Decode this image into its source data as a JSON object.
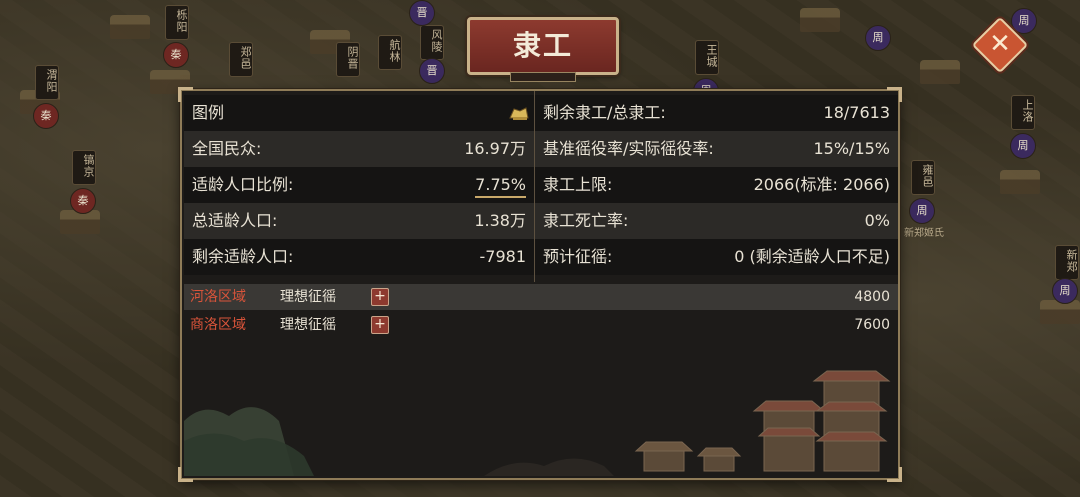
{
  "title": "隶工",
  "close_icon": "close-icon",
  "left_stats": [
    {
      "label": "图例",
      "value": "",
      "icon": "legend-icon"
    },
    {
      "label": "全国民众:",
      "value": "16.97万"
    },
    {
      "label": "适龄人口比例:",
      "value": "7.75%"
    },
    {
      "label": "总适龄人口:",
      "value": "1.38万"
    },
    {
      "label": "剩余适龄人口:",
      "value": "-7981"
    }
  ],
  "right_stats": [
    {
      "label": "剩余隶工/总隶工:",
      "value": "18/7613"
    },
    {
      "label": "基准徭役率/实际徭役率:",
      "value": "15%/15%"
    },
    {
      "label": "隶工上限:",
      "value": "2066(标准: 2066)"
    },
    {
      "label": "隶工死亡率:",
      "value": "0%"
    },
    {
      "label": "预计征徭:",
      "value": "0 (剩余适龄人口不足)"
    }
  ],
  "regions": [
    {
      "name": "河洛区域",
      "mode": "理想征徭",
      "plus": "+",
      "value": "4800"
    },
    {
      "name": "商洛区域",
      "mode": "理想征徭",
      "plus": "+",
      "value": "7600"
    }
  ],
  "map_labels": [
    {
      "text": "栎阳"
    },
    {
      "text": "郑邑"
    },
    {
      "text": "阴晋"
    },
    {
      "text": "航林"
    },
    {
      "text": "风陵"
    },
    {
      "text": "渭阳"
    },
    {
      "text": "镐京"
    },
    {
      "text": "上洛"
    },
    {
      "text": "王城"
    },
    {
      "text": "新郑"
    },
    {
      "text": "雍邑"
    }
  ],
  "map_badges": [
    {
      "text": "秦",
      "color": "#6e2722"
    },
    {
      "text": "秦",
      "color": "#6e2722"
    },
    {
      "text": "秦",
      "color": "#6e2722"
    },
    {
      "text": "晋",
      "color": "#3b2a5e"
    },
    {
      "text": "晋",
      "color": "#3b2a5e"
    },
    {
      "text": "周",
      "color": "#3b2a5e"
    },
    {
      "text": "周",
      "color": "#3b2a5e"
    },
    {
      "text": "周",
      "color": "#3b2a5e"
    },
    {
      "text": "周",
      "color": "#3b2a5e"
    },
    {
      "text": "周",
      "color": "#3b2a5e"
    },
    {
      "text": "周",
      "color": "#3b2a5e"
    }
  ],
  "map_place": "新郑姬氏",
  "colors": {
    "panel_bg": "#1d1b19",
    "title_red": "#8d3a2f",
    "region_red": "#d9543a",
    "gold_border": "#c9b28a"
  }
}
